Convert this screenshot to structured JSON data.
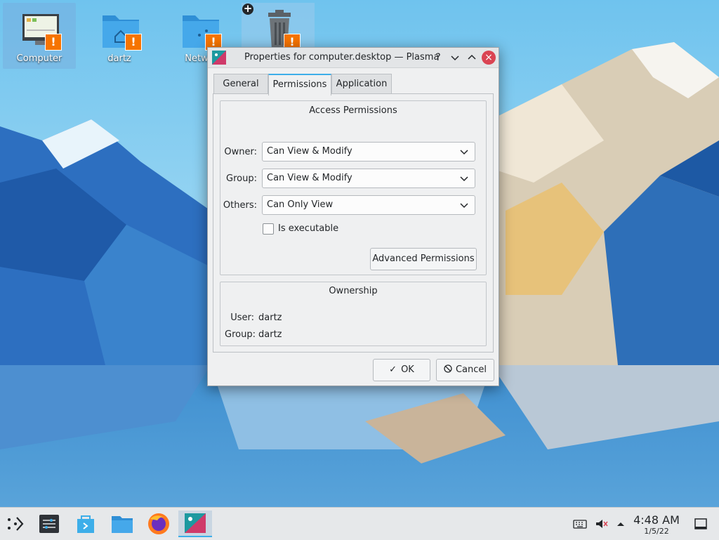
{
  "desktop": {
    "icons": [
      {
        "label": "Computer",
        "icon": "computer-icon"
      },
      {
        "label": "dartz",
        "icon": "home-folder-icon"
      },
      {
        "label": "Netwo",
        "icon": "network-folder-icon"
      },
      {
        "label": "",
        "icon": "trash-icon"
      }
    ],
    "warning_badge": "!",
    "add_badge": "+"
  },
  "dialog": {
    "title": "Properties for computer.desktop — Plasma",
    "titlebar_buttons": {
      "help": "?",
      "minimize": "⌄",
      "maximize": "⌃",
      "close": "×"
    },
    "tabs": [
      {
        "label": "General"
      },
      {
        "label": "Permissions",
        "active": true
      },
      {
        "label": "Application"
      }
    ],
    "access": {
      "title": "Access Permissions",
      "owner_label": "Owner:",
      "owner_value": "Can View & Modify",
      "group_label": "Group:",
      "group_value": "Can View & Modify",
      "others_label": "Others:",
      "others_value": "Can Only View",
      "executable_label": "Is executable",
      "executable_checked": false,
      "advanced_button": "Advanced Permissions"
    },
    "ownership": {
      "title": "Ownership",
      "user_label": "User:",
      "user_value": "dartz",
      "group_label": "Group:",
      "group_value": "dartz"
    },
    "ok_button": "OK",
    "cancel_button": "Cancel"
  },
  "taskbar": {
    "items": [
      "application-launcher-icon",
      "system-settings-icon",
      "discover-icon",
      "dolphin-icon",
      "firefox-icon",
      "properties-window-icon"
    ],
    "tray": [
      "keyboard-icon",
      "volume-muted-icon",
      "expand-tray-icon"
    ],
    "time": "4:48 AM",
    "date": "1/5/22"
  },
  "colors": {
    "accent": "#3daee9",
    "warning": "#f67400",
    "close": "#da4453"
  }
}
